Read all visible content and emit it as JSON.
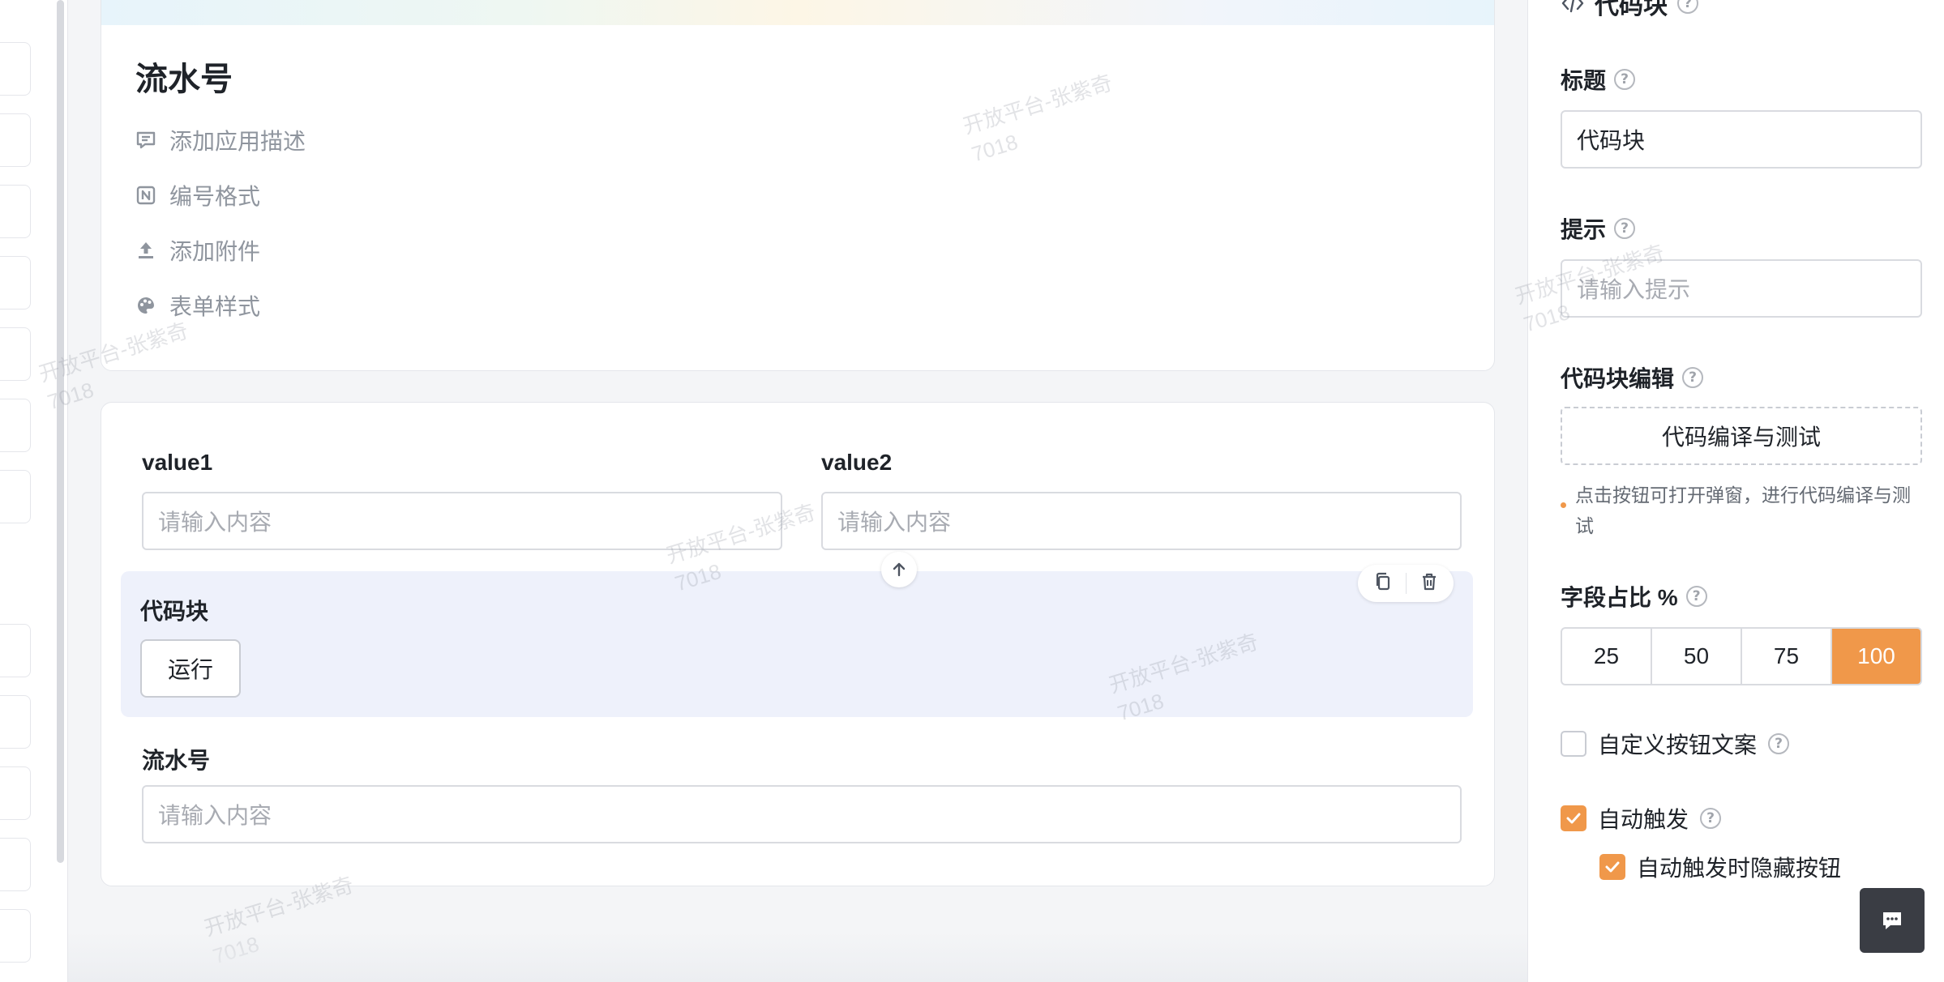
{
  "header": {
    "title": "流水号",
    "meta": [
      {
        "icon": "comment-icon",
        "label": "添加应用描述"
      },
      {
        "icon": "numbering-icon",
        "label": "编号格式"
      },
      {
        "icon": "upload-icon",
        "label": "添加附件"
      },
      {
        "icon": "palette-icon",
        "label": "表单样式"
      }
    ]
  },
  "fields": {
    "value1": {
      "label": "value1",
      "placeholder": "请输入内容"
    },
    "value2": {
      "label": "value2",
      "placeholder": "请输入内容"
    },
    "code_block": {
      "label": "代码块",
      "run_label": "运行"
    },
    "serial": {
      "label": "流水号",
      "placeholder": "请输入内容"
    }
  },
  "watermark": {
    "text": "开放平台-张紫奇",
    "id": "7018"
  },
  "panel": {
    "header": "代码块",
    "title_label": "标题",
    "title_value": "代码块",
    "hint_label": "提示",
    "hint_placeholder": "请输入提示",
    "editor_label": "代码块编辑",
    "editor_button": "代码编译与测试",
    "editor_hint": "点击按钮可打开弹窗，进行代码编译与测试",
    "ratio_label": "字段占比 %",
    "ratio_options": [
      "25",
      "50",
      "75",
      "100"
    ],
    "ratio_selected": "100",
    "custom_btn_label": "自定义按钮文案",
    "custom_btn_checked": false,
    "auto_trigger_label": "自动触发",
    "auto_trigger_checked": true,
    "hide_btn_label": "自动触发时隐藏按钮",
    "hide_btn_checked": true
  },
  "colors": {
    "accent": "#f0984a",
    "code_block_bg": "#eef1fb"
  }
}
